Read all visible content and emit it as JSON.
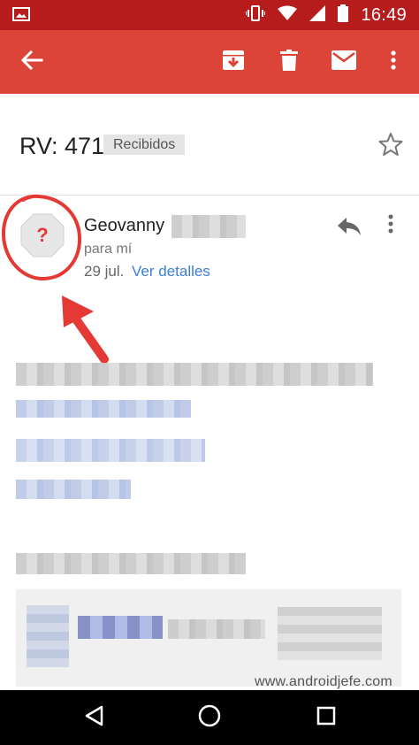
{
  "status_bar": {
    "time": "16:49",
    "icons": [
      "image-icon",
      "vibrate-icon",
      "wifi-icon",
      "signal-icon",
      "battery-icon"
    ]
  },
  "toolbar": {
    "back_icon": "arrow-left-icon",
    "archive_icon": "archive-icon",
    "delete_icon": "trash-icon",
    "mark_unread_icon": "mail-icon",
    "more_icon": "more-vert-icon"
  },
  "message": {
    "subject": "RV: 471",
    "label": "Recibidos",
    "sender_name": "Geovanny",
    "recipient": "para mí",
    "date": "29 jul.",
    "details_link": "Ver detalles"
  },
  "watermark": "www.androidjefe.com",
  "colors": {
    "status_bar": "#b71c1c",
    "app_bar": "#db4437",
    "link": "#3d7fd6",
    "annotation": "#e53935"
  }
}
